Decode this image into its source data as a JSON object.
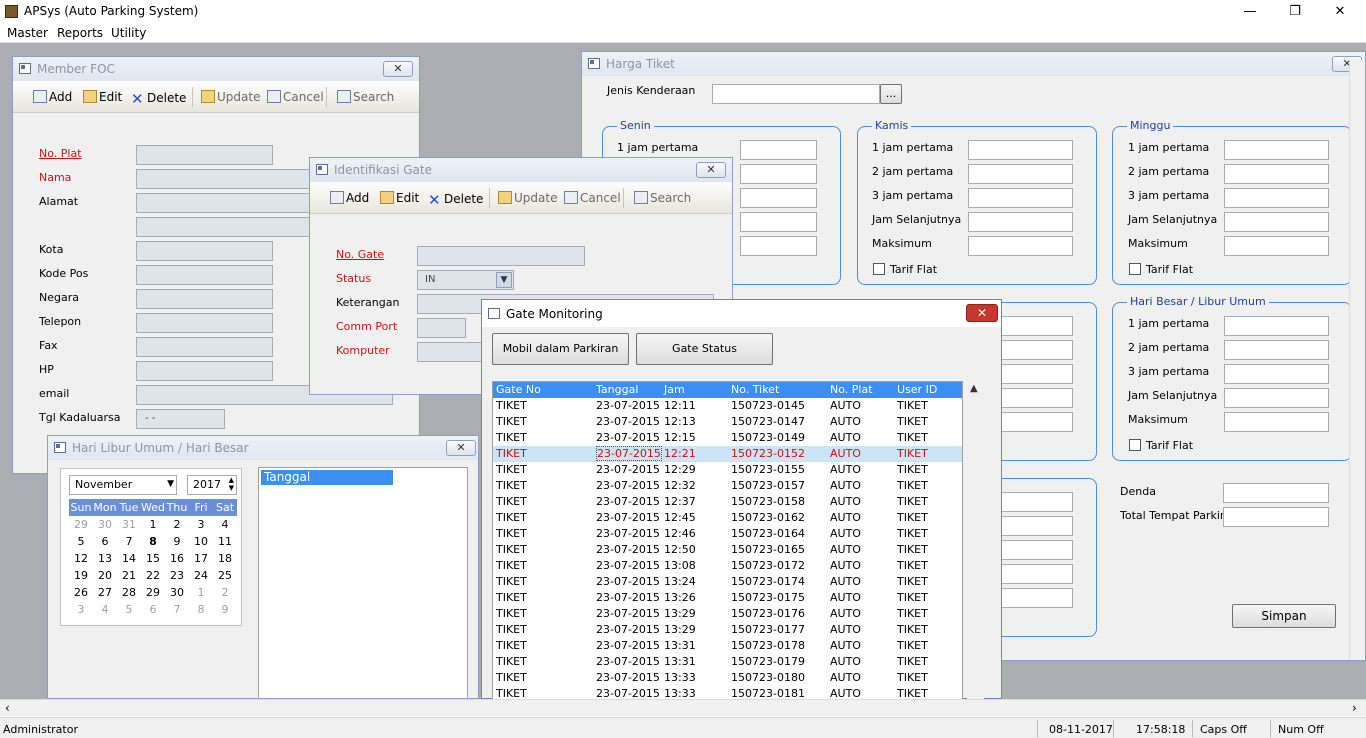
{
  "app": {
    "title": "APSys (Auto Parking System)",
    "min": "—",
    "max": "❐",
    "close": "✕"
  },
  "menu": [
    "Master",
    "Reports",
    "Utility"
  ],
  "toolbar": {
    "add": "Add",
    "edit": "Edit",
    "delete": "Delete",
    "update": "Update",
    "cancel": "Cancel",
    "search": "Search"
  },
  "member": {
    "title": "Member FOC",
    "labels": [
      "No. Plat",
      "Nama",
      "Alamat",
      "Kota",
      "Kode Pos",
      "Negara",
      "Telepon",
      "Fax",
      "HP",
      "email",
      "Tgl Kadaluarsa"
    ],
    "date_value": "-  -"
  },
  "gate": {
    "title": "Identifikasi Gate",
    "labels": [
      "No. Gate",
      "Status",
      "Keterangan",
      "Comm Port",
      "Komputer"
    ],
    "status_value": "IN"
  },
  "harga": {
    "title": "Harga Tiket",
    "jenis_label": "Jenis Kenderaan",
    "browse": "...",
    "groups": {
      "senin": "Senin",
      "kamis": "Kamis",
      "minggu": "Minggu",
      "libur": "Hari Besar / Libur Umum"
    },
    "rows": [
      "1 jam pertama",
      "2 jam pertama",
      "3 jam pertama",
      "Jam Selanjutnya",
      "Maksimum"
    ],
    "tarif_flat": "Tarif Flat",
    "denda": "Denda",
    "total": "Total Tempat Parkir",
    "simpan": "Simpan"
  },
  "libur": {
    "title": "Hari Libur Umum / Hari Besar",
    "month": "November",
    "year": "2017",
    "list_header": "Tanggal",
    "weekdays": [
      "Sun",
      "Mon",
      "Tue",
      "Wed",
      "Thu",
      "Fri",
      "Sat"
    ],
    "weeks": [
      [
        "29",
        "30",
        "31",
        "1",
        "2",
        "3",
        "4"
      ],
      [
        "5",
        "6",
        "7",
        "8",
        "9",
        "10",
        "11"
      ],
      [
        "12",
        "13",
        "14",
        "15",
        "16",
        "17",
        "18"
      ],
      [
        "19",
        "20",
        "21",
        "22",
        "23",
        "24",
        "25"
      ],
      [
        "26",
        "27",
        "28",
        "29",
        "30",
        "1",
        "2"
      ],
      [
        "3",
        "4",
        "5",
        "6",
        "7",
        "8",
        "9"
      ]
    ]
  },
  "monitor": {
    "title": "Gate Monitoring",
    "btn_mobil": "Mobil dalam Parkiran",
    "btn_status": "Gate Status",
    "columns": [
      "Gate No",
      "Tanggal",
      "Jam",
      "No. Tiket",
      "No. Plat",
      "User ID"
    ],
    "rows": [
      [
        "TIKET",
        "23-07-2015",
        "12:11",
        "150723-0145",
        "AUTO",
        "TIKET"
      ],
      [
        "TIKET",
        "23-07-2015",
        "12:13",
        "150723-0147",
        "AUTO",
        "TIKET"
      ],
      [
        "TIKET",
        "23-07-2015",
        "12:15",
        "150723-0149",
        "AUTO",
        "TIKET"
      ],
      [
        "TIKET",
        "23-07-2015",
        "12:21",
        "150723-0152",
        "AUTO",
        "TIKET"
      ],
      [
        "TIKET",
        "23-07-2015",
        "12:29",
        "150723-0155",
        "AUTO",
        "TIKET"
      ],
      [
        "TIKET",
        "23-07-2015",
        "12:32",
        "150723-0157",
        "AUTO",
        "TIKET"
      ],
      [
        "TIKET",
        "23-07-2015",
        "12:37",
        "150723-0158",
        "AUTO",
        "TIKET"
      ],
      [
        "TIKET",
        "23-07-2015",
        "12:45",
        "150723-0162",
        "AUTO",
        "TIKET"
      ],
      [
        "TIKET",
        "23-07-2015",
        "12:46",
        "150723-0164",
        "AUTO",
        "TIKET"
      ],
      [
        "TIKET",
        "23-07-2015",
        "12:50",
        "150723-0165",
        "AUTO",
        "TIKET"
      ],
      [
        "TIKET",
        "23-07-2015",
        "13:08",
        "150723-0172",
        "AUTO",
        "TIKET"
      ],
      [
        "TIKET",
        "23-07-2015",
        "13:24",
        "150723-0174",
        "AUTO",
        "TIKET"
      ],
      [
        "TIKET",
        "23-07-2015",
        "13:26",
        "150723-0175",
        "AUTO",
        "TIKET"
      ],
      [
        "TIKET",
        "23-07-2015",
        "13:29",
        "150723-0176",
        "AUTO",
        "TIKET"
      ],
      [
        "TIKET",
        "23-07-2015",
        "13:29",
        "150723-0177",
        "AUTO",
        "TIKET"
      ],
      [
        "TIKET",
        "23-07-2015",
        "13:31",
        "150723-0178",
        "AUTO",
        "TIKET"
      ],
      [
        "TIKET",
        "23-07-2015",
        "13:31",
        "150723-0179",
        "AUTO",
        "TIKET"
      ],
      [
        "TIKET",
        "23-07-2015",
        "13:33",
        "150723-0180",
        "AUTO",
        "TIKET"
      ],
      [
        "TIKET",
        "23-07-2015",
        "13:33",
        "150723-0181",
        "AUTO",
        "TIKET"
      ]
    ],
    "selected_index": 3
  },
  "status": {
    "user": "Administrator",
    "date": "08-11-2017",
    "time": "17:58:18",
    "caps": "Caps Off",
    "num": "Num Off"
  },
  "icons": [
    "app-icon",
    "window-icon",
    "add-icon",
    "edit-icon",
    "delete-icon",
    "update-icon",
    "cancel-icon",
    "search-icon",
    "checkbox-icon",
    "scroll-arrow-icon"
  ]
}
